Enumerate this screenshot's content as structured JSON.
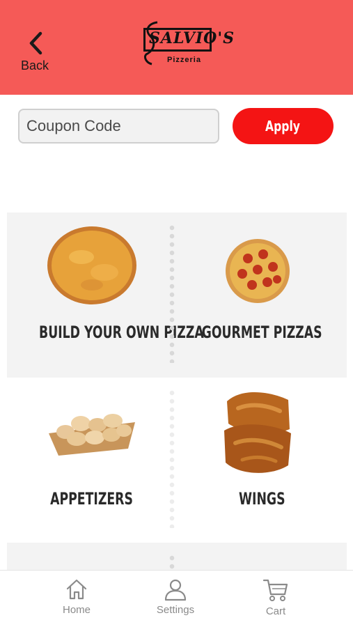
{
  "header": {
    "back_label": "Back",
    "logo_text": "SALVIO'S",
    "logo_subtitle": "Pizzeria",
    "back_icon": "chevron-left-icon",
    "background_color": "#f55a57"
  },
  "coupon": {
    "placeholder": "Coupon Code",
    "value": "",
    "apply_label": "Apply",
    "apply_color": "#f41414"
  },
  "categories": [
    {
      "label": "BUILD YOUR OWN PIZZA",
      "image": "cheese-pizza-image"
    },
    {
      "label": "GOURMET PIZZAS",
      "image": "pepperoni-pizza-image"
    },
    {
      "label": "APPETIZERS",
      "image": "garlic-knots-basket-image"
    },
    {
      "label": "WINGS",
      "image": "chicken-wings-image"
    }
  ],
  "bottom_nav": [
    {
      "label": "Home",
      "icon": "home-icon"
    },
    {
      "label": "Settings",
      "icon": "user-icon"
    },
    {
      "label": "Cart",
      "icon": "cart-icon"
    }
  ]
}
